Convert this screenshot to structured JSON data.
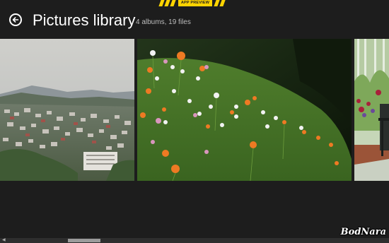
{
  "banner": {
    "label": "APP PREVIEW",
    "color": "#ffd400"
  },
  "header": {
    "back_icon": "back-arrow-icon",
    "title": "Pictures library",
    "subtitle": "4 albums, 19 files"
  },
  "tiles": [
    {
      "subject": "city-hillside-photo"
    },
    {
      "subject": "cosmos-flower-meadow-photo"
    },
    {
      "subject": "garden-bench-photo"
    }
  ],
  "watermark": {
    "text": "BodNara"
  }
}
